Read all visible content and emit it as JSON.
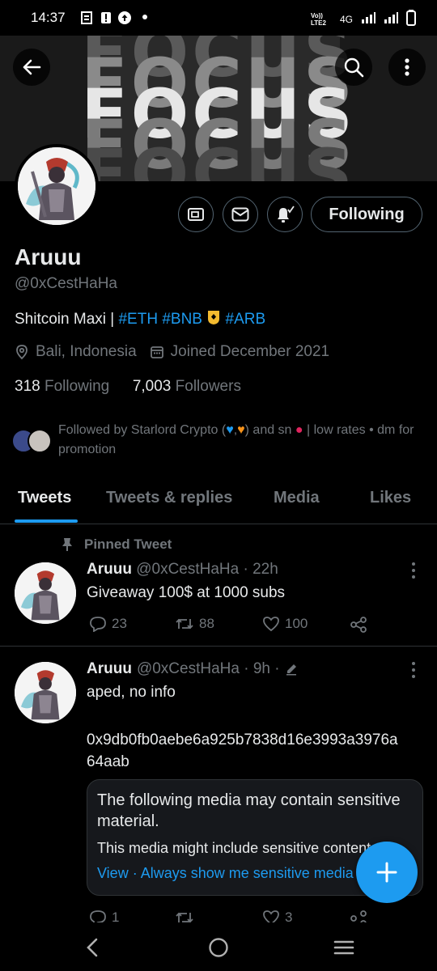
{
  "status_bar": {
    "time": "14:37",
    "network_label": "Vo)) LTE2",
    "network_type": "4G"
  },
  "banner": {
    "text": "FOCUS"
  },
  "profile": {
    "name": "Aruuu",
    "handle": "@0xCestHaHa",
    "bio_prefix": "Shitcoin Maxi | ",
    "bio_tag_eth": "#ETH",
    "bio_tag_bnb": "#BNB",
    "bio_tag_arb": "#ARB",
    "location": "Bali, Indonesia",
    "joined": "Joined December 2021",
    "following_count": "318",
    "following_label": "Following",
    "followers_count": "7,003",
    "followers_label": "Followers",
    "followed_by_prefix": "Followed by Starlord Crypto (",
    "followed_by_mid": ",",
    "followed_by_suffix": ") and sn",
    "followed_by_rest": " | low rates • dm for promotion",
    "following_button": "Following"
  },
  "tabs": [
    {
      "label": "Tweets"
    },
    {
      "label": "Tweets & replies"
    },
    {
      "label": "Media"
    },
    {
      "label": "Likes"
    }
  ],
  "tweets": [
    {
      "pinned_label": "Pinned Tweet",
      "name": "Aruuu",
      "meta": "@0xCestHaHa · 22h",
      "text": "Giveaway 100$ at 1000 subs",
      "replies": "23",
      "retweets": "88",
      "likes": "100"
    },
    {
      "name": "Aruuu",
      "meta": "@0xCestHaHa · 9h ·",
      "text": "aped, no info",
      "text2": "0x9db0fb0aebe6a925b7838d16e3993a3976a64aab",
      "sensitive_title": "The following media may contain sensitive material.",
      "sensitive_sub": "This media might include sensitive content",
      "view_label": "View",
      "always_show_label": "Always show me sensitive media",
      "replies": "1",
      "retweets": "",
      "likes": "3"
    }
  ],
  "colors": {
    "accent": "#1d9bf0",
    "background": "#000000",
    "muted": "#71767b",
    "text": "#e7e9ea"
  }
}
